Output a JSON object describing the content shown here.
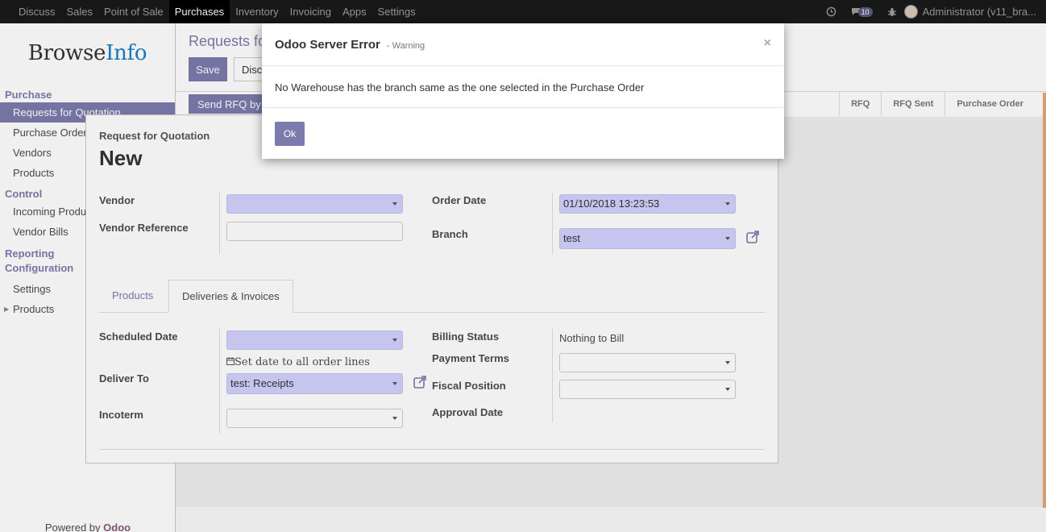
{
  "topbar": {
    "menu": [
      "Discuss",
      "Sales",
      "Point of Sale",
      "Purchases",
      "Inventory",
      "Invoicing",
      "Apps",
      "Settings"
    ],
    "active_index": 3,
    "message_count": "10",
    "user": "Administrator (v11_bra..."
  },
  "sidebar": {
    "logo_a": "Browse",
    "logo_b": "Info",
    "sections": [
      {
        "title": "Purchase",
        "items": [
          "Requests for Quotation",
          "Purchase Orders",
          "Vendors",
          "Products"
        ]
      },
      {
        "title": "Control",
        "items": [
          "Incoming Products",
          "Vendor Bills"
        ]
      },
      {
        "title": "Reporting"
      },
      {
        "title": "Configuration",
        "items": [
          "Settings",
          "Products"
        ]
      }
    ],
    "powered_by": "Powered by",
    "powered_brand": "Odoo"
  },
  "control_panel": {
    "breadcrumb": "Requests for Quotation / New",
    "save": "Save",
    "discard": "Discard",
    "send_rfq": "Send RFQ by Email",
    "stages": [
      "RFQ",
      "RFQ Sent",
      "Purchase Order"
    ]
  },
  "form": {
    "subtitle": "Request for Quotation",
    "title": "New",
    "vendor_label": "Vendor",
    "vendor_value": "",
    "vendor_ref_label": "Vendor Reference",
    "vendor_ref_value": "",
    "order_date_label": "Order Date",
    "order_date_value": "01/10/2018 13:23:53",
    "branch_label": "Branch",
    "branch_value": "test",
    "tabs": [
      "Products",
      "Deliveries & Invoices"
    ],
    "active_tab": 1,
    "scheduled_date_label": "Scheduled Date",
    "set_date_text": "Set date to all order lines",
    "deliver_to_label": "Deliver To",
    "deliver_to_value": "test: Receipts",
    "incoterm_label": "Incoterm",
    "billing_status_label": "Billing Status",
    "billing_status_value": "Nothing to Bill",
    "payment_terms_label": "Payment Terms",
    "fiscal_position_label": "Fiscal Position",
    "approval_date_label": "Approval Date"
  },
  "modal": {
    "title": "Odoo Server Error",
    "subtitle": "- Warning",
    "message": "No Warehouse has the branch same as the one selected in the Purchase Order",
    "ok": "Ok",
    "close": "×"
  },
  "colors": {
    "accent": "#7c7bad",
    "topbar": "#1a1a1a",
    "required_field": "#d2d2ff"
  }
}
